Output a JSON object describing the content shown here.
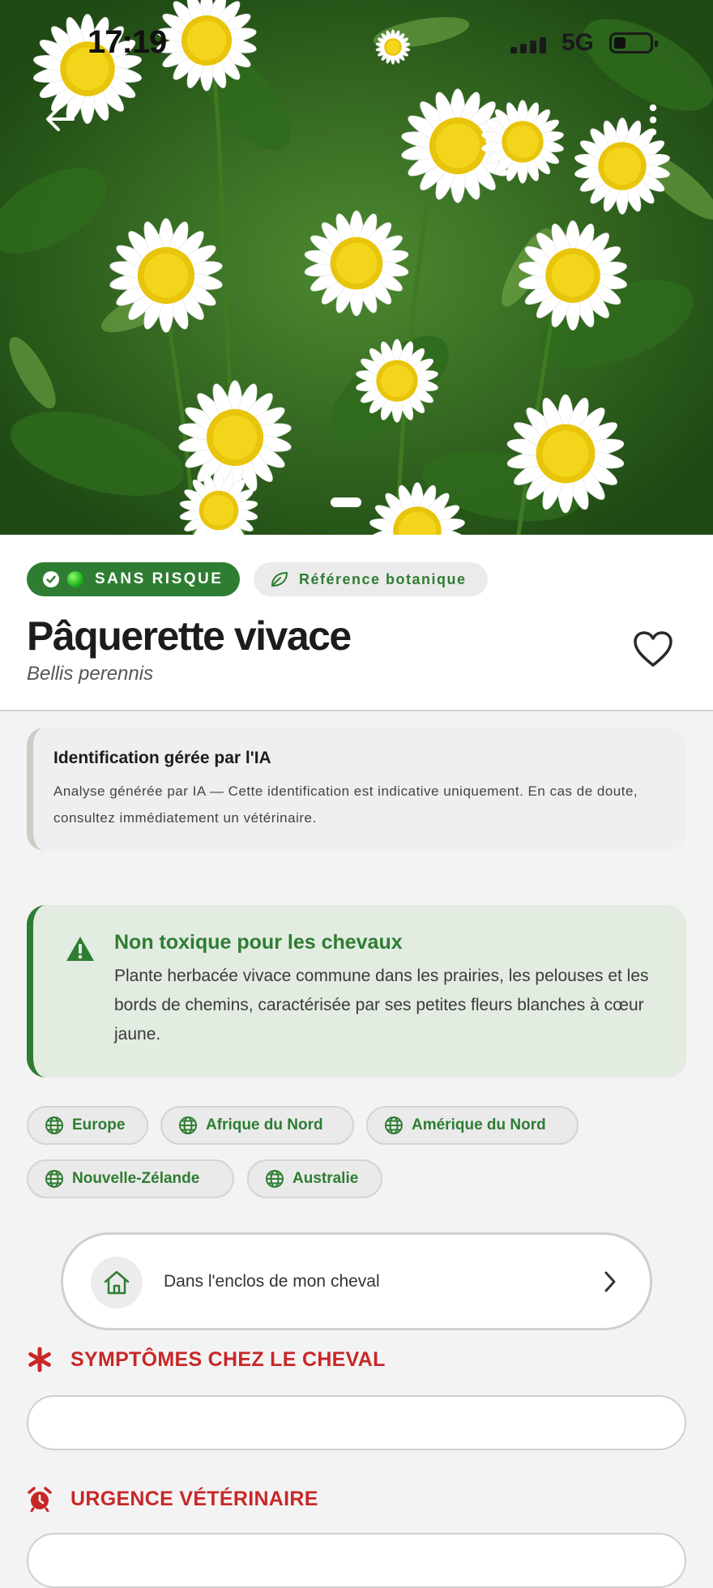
{
  "status_bar": {
    "time": "17:19",
    "network": "5G"
  },
  "hero": {
    "pager_total": 1,
    "pager_active": 1
  },
  "header": {
    "badge_safe": "SANS RISQUE",
    "badge_reference": "Référence botanique",
    "title": "Pâquerette vivace",
    "scientific_name": "Bellis perennis"
  },
  "ai_notice": {
    "title": "Identification gérée par l'IA",
    "text": "Analyse générée par IA — Cette identification est indicative uniquement. En cas de doute, consultez immédiatement un vétérinaire."
  },
  "toxicity": {
    "title": "Non toxique pour les chevaux",
    "description": "Plante herbacée vivace commune dans les prairies, les pelouses et les bords de chemins, caractérisée par ses petites fleurs blanches à cœur jaune."
  },
  "regions": [
    "Europe",
    "Afrique du Nord",
    "Amérique du Nord",
    "Nouvelle-Zélande",
    "Australie"
  ],
  "enclos_button": {
    "label": "Dans l'enclos de mon cheval"
  },
  "sections": {
    "symptoms": "SYMPTÔMES CHEZ LE CHEVAL",
    "emergency": "URGENCE VÉTÉRINAIRE"
  },
  "colors": {
    "accent_green": "#2e7d32",
    "danger_red": "#c62828",
    "safe_light_bg": "#e2ece1"
  },
  "icons": {
    "back": "arrow-left-icon",
    "menu": "more-vertical-icon",
    "favorite": "heart-outline-icon",
    "check": "check-circle-icon",
    "leaf": "leaf-icon",
    "warning": "warning-triangle-icon",
    "globe": "globe-icon",
    "home": "home-icon",
    "chevron": "chevron-right-icon",
    "asterisk": "asterisk-icon",
    "alarm": "alarm-clock-icon"
  }
}
